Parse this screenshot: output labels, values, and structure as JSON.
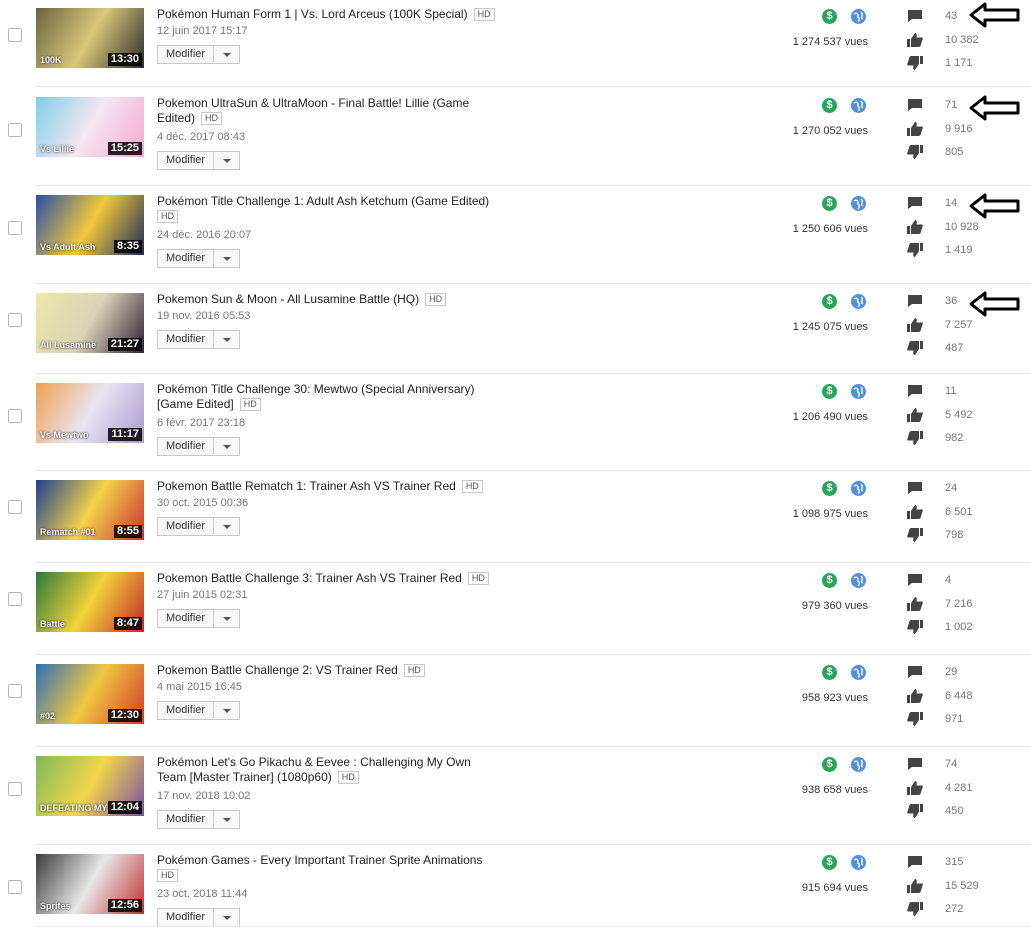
{
  "views_suffix": "vues",
  "modifier_label": "Modifier",
  "hd_label": "HD",
  "money_glyph": "$",
  "colors": {
    "monetization": "#26a65b",
    "public": "#4f8fe0"
  },
  "videos": [
    {
      "title": "Pokémon Human Form 1 | Vs. Lord Arceus (100K Special)",
      "hd": true,
      "date": "12 juin 2017 15:17",
      "duration": "13:30",
      "views": "1 274 537",
      "comments": "43",
      "likes": "10 382",
      "dislikes": "1 171",
      "thumb_caption": "100K",
      "thumb_colors": [
        "#6b6340",
        "#d8c879",
        "#2b2b2b"
      ]
    },
    {
      "title": "Pokemon UltraSun & UltraMoon - Final Battle! Lillie (Game Edited)",
      "hd": true,
      "date": "4 déc. 2017 08:43",
      "duration": "15:25",
      "views": "1 270 052",
      "comments": "71",
      "likes": "9 916",
      "dislikes": "805",
      "thumb_caption": "Vs Lillie",
      "thumb_colors": [
        "#7fcfe8",
        "#f5e6f1",
        "#f3a7d0"
      ]
    },
    {
      "title": "Pokémon Title Challenge 1: Adult Ash Ketchum (Game Edited)",
      "hd": true,
      "date": "24 déc. 2016 20:07",
      "duration": "8:35",
      "views": "1 250 606",
      "comments": "14",
      "likes": "10 928",
      "dislikes": "1 419",
      "thumb_caption": "Vs Adult Ash",
      "thumb_colors": [
        "#2a4fa8",
        "#f2c93b",
        "#1b2a5c"
      ]
    },
    {
      "title": "Pokemon Sun & Moon - All Lusamine Battle (HQ)",
      "hd": true,
      "date": "19 nov. 2016 05:53",
      "duration": "21:27",
      "views": "1 245 075",
      "comments": "36",
      "likes": "7 257",
      "dislikes": "487",
      "thumb_caption": "All Lusamine",
      "thumb_colors": [
        "#efe6a8",
        "#d9d3b8",
        "#2b2232"
      ]
    },
    {
      "title": "Pokémon Title Challenge 30: Mewtwo (Special Anniversary) [Game Edited]",
      "hd": true,
      "date": "6 févr. 2017 23:18",
      "duration": "11:17",
      "views": "1 206 490",
      "comments": "11",
      "likes": "5 492",
      "dislikes": "982",
      "thumb_caption": "Vs Mewtwo",
      "thumb_colors": [
        "#f0a050",
        "#e9e4f2",
        "#a99ad0"
      ]
    },
    {
      "title": "Pokemon Battle Rematch 1: Trainer Ash VS Trainer Red",
      "hd": true,
      "date": "30 oct. 2015 00:36",
      "duration": "8:55",
      "views": "1 098 975",
      "comments": "24",
      "likes": "6 501",
      "dislikes": "798",
      "thumb_caption": "Rematch #01",
      "thumb_colors": [
        "#1e3f8f",
        "#f3d34a",
        "#c93030"
      ]
    },
    {
      "title": "Pokemon Battle Challenge 3: Trainer Ash VS Trainer Red",
      "hd": true,
      "date": "27 juin 2015 02:31",
      "duration": "8:47",
      "views": "979 360",
      "comments": "4",
      "likes": "7 216",
      "dislikes": "1 002",
      "thumb_caption": "Battle",
      "thumb_colors": [
        "#2c7a3c",
        "#f2d23a",
        "#c02828"
      ]
    },
    {
      "title": "Pokemon Battle Challenge 2: VS Trainer Red",
      "hd": true,
      "date": "4 mai 2015 16:45",
      "duration": "12:30",
      "views": "958 923",
      "comments": "29",
      "likes": "6 448",
      "dislikes": "971",
      "thumb_caption": "#02",
      "thumb_colors": [
        "#2f6fb8",
        "#f0c840",
        "#d23b2b"
      ]
    },
    {
      "title": "Pokémon Let's Go Pikachu & Eevee : Challenging My Own Team [Master Trainer] (1080p60)",
      "hd": true,
      "date": "17 nov. 2018 10:02",
      "duration": "12:04",
      "views": "938 658",
      "comments": "74",
      "likes": "4 281",
      "dislikes": "450",
      "thumb_caption": "DEFEATING MY OWN",
      "thumb_colors": [
        "#7dbb5a",
        "#f3d54a",
        "#7b4fa8"
      ]
    },
    {
      "title": "Pokémon Games - Every Important Trainer Sprite Animations",
      "hd": true,
      "date": "23 oct. 2018 11:44",
      "duration": "12:56",
      "views": "915 694",
      "comments": "315",
      "likes": "15 529",
      "dislikes": "272",
      "thumb_caption": "Sprites",
      "thumb_colors": [
        "#3a3a3a",
        "#e8e8e8",
        "#c03030"
      ]
    }
  ]
}
